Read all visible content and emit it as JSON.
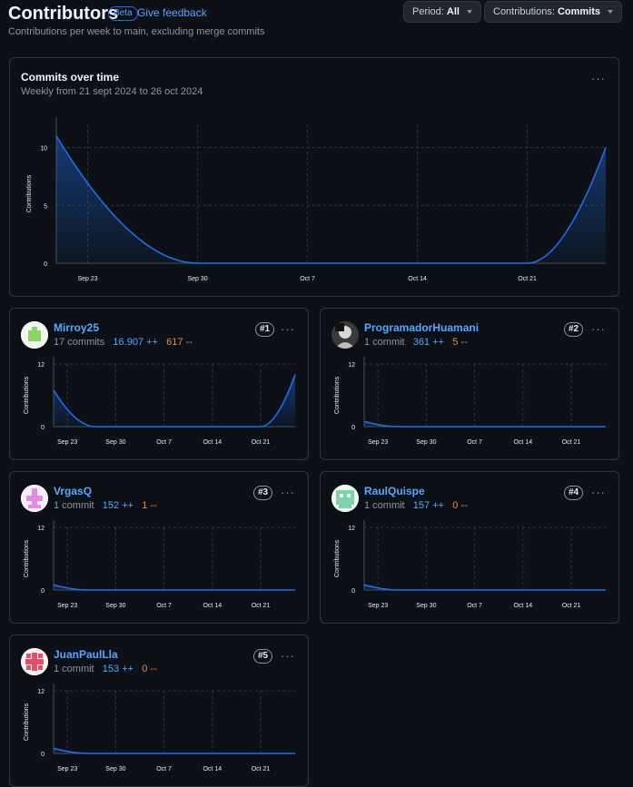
{
  "header": {
    "title": "Contributors",
    "beta": "Beta",
    "feedback": "Give feedback",
    "subtitle": "Contributions per week to main, excluding merge commits",
    "period_label": "Period: ",
    "period_value": "All",
    "contrib_label": "Contributions: ",
    "contrib_value": "Commits"
  },
  "main_chart": {
    "title": "Commits over time",
    "subtitle": "Weekly from 21 sept 2024 to 26 oct 2024",
    "more": "···",
    "ylabel": "Contributions",
    "yticks": [
      "0",
      "5",
      "10"
    ]
  },
  "xticks": [
    "Sep 23",
    "Sep 30",
    "Oct 7",
    "Oct 14",
    "Oct 21"
  ],
  "contributors": [
    {
      "name": "Mirroy25",
      "commits": "17 commits",
      "additions": "16.907 ++",
      "deletions": "617 --",
      "rank": "#1",
      "more": "···",
      "ylabel": "Contributions",
      "ytop": "12",
      "ybottom": "0"
    },
    {
      "name": "ProgramadorHuamani",
      "commits": "1 commit",
      "additions": "361 ++",
      "deletions": "5 --",
      "rank": "#2",
      "more": "···",
      "ylabel": "Contributions",
      "ytop": "12",
      "ybottom": "0"
    },
    {
      "name": "VrgasQ",
      "commits": "1 commit",
      "additions": "152 ++",
      "deletions": "1 --",
      "rank": "#3",
      "more": "···",
      "ylabel": "Contributions",
      "ytop": "12",
      "ybottom": "0"
    },
    {
      "name": "RaulQuispe",
      "commits": "1 commit",
      "additions": "157 ++",
      "deletions": "0 --",
      "rank": "#4",
      "more": "···",
      "ylabel": "Contributions",
      "ytop": "12",
      "ybottom": "0"
    },
    {
      "name": "JuanPaulLla",
      "commits": "1 commit",
      "additions": "153 ++",
      "deletions": "0 --",
      "rank": "#5",
      "more": "···",
      "ylabel": "Contributions",
      "ytop": "12",
      "ybottom": "0"
    }
  ],
  "colors": {
    "line": "#1f6feb",
    "link": "#58a6ff",
    "deletions": "#f0883e",
    "grid": "#30363d"
  },
  "chart_data": [
    {
      "type": "area",
      "title": "Commits over time",
      "ylabel": "Contributions",
      "ylim": [
        0,
        12
      ],
      "x": [
        "2024-09-21",
        "2024-09-30",
        "2024-10-21",
        "2024-10-26"
      ],
      "series": [
        {
          "values": [
            11,
            0,
            0,
            10
          ]
        }
      ]
    },
    {
      "type": "area",
      "title": "Mirroy25",
      "ylabel": "Contributions",
      "ylim": [
        0,
        12
      ],
      "x": [
        "2024-09-21",
        "2024-09-27",
        "2024-10-21",
        "2024-10-26"
      ],
      "series": [
        {
          "values": [
            7,
            0,
            0,
            10
          ]
        }
      ]
    },
    {
      "type": "area",
      "title": "ProgramadorHuamani",
      "ylabel": "Contributions",
      "ylim": [
        0,
        12
      ],
      "x": [
        "2024-09-21",
        "2024-09-26",
        "2024-10-26"
      ],
      "series": [
        {
          "values": [
            1,
            0,
            0
          ]
        }
      ]
    },
    {
      "type": "area",
      "title": "VrgasQ",
      "ylabel": "Contributions",
      "ylim": [
        0,
        12
      ],
      "x": [
        "2024-09-21",
        "2024-09-26",
        "2024-10-26"
      ],
      "series": [
        {
          "values": [
            1,
            0,
            0
          ]
        }
      ]
    },
    {
      "type": "area",
      "title": "RaulQuispe",
      "ylabel": "Contributions",
      "ylim": [
        0,
        12
      ],
      "x": [
        "2024-09-21",
        "2024-09-26",
        "2024-10-26"
      ],
      "series": [
        {
          "values": [
            1,
            0,
            0
          ]
        }
      ]
    },
    {
      "type": "area",
      "title": "JuanPaulLla",
      "ylabel": "Contributions",
      "ylim": [
        0,
        12
      ],
      "x": [
        "2024-09-21",
        "2024-09-26",
        "2024-10-26"
      ],
      "series": [
        {
          "values": [
            1,
            0,
            0
          ]
        }
      ]
    }
  ]
}
